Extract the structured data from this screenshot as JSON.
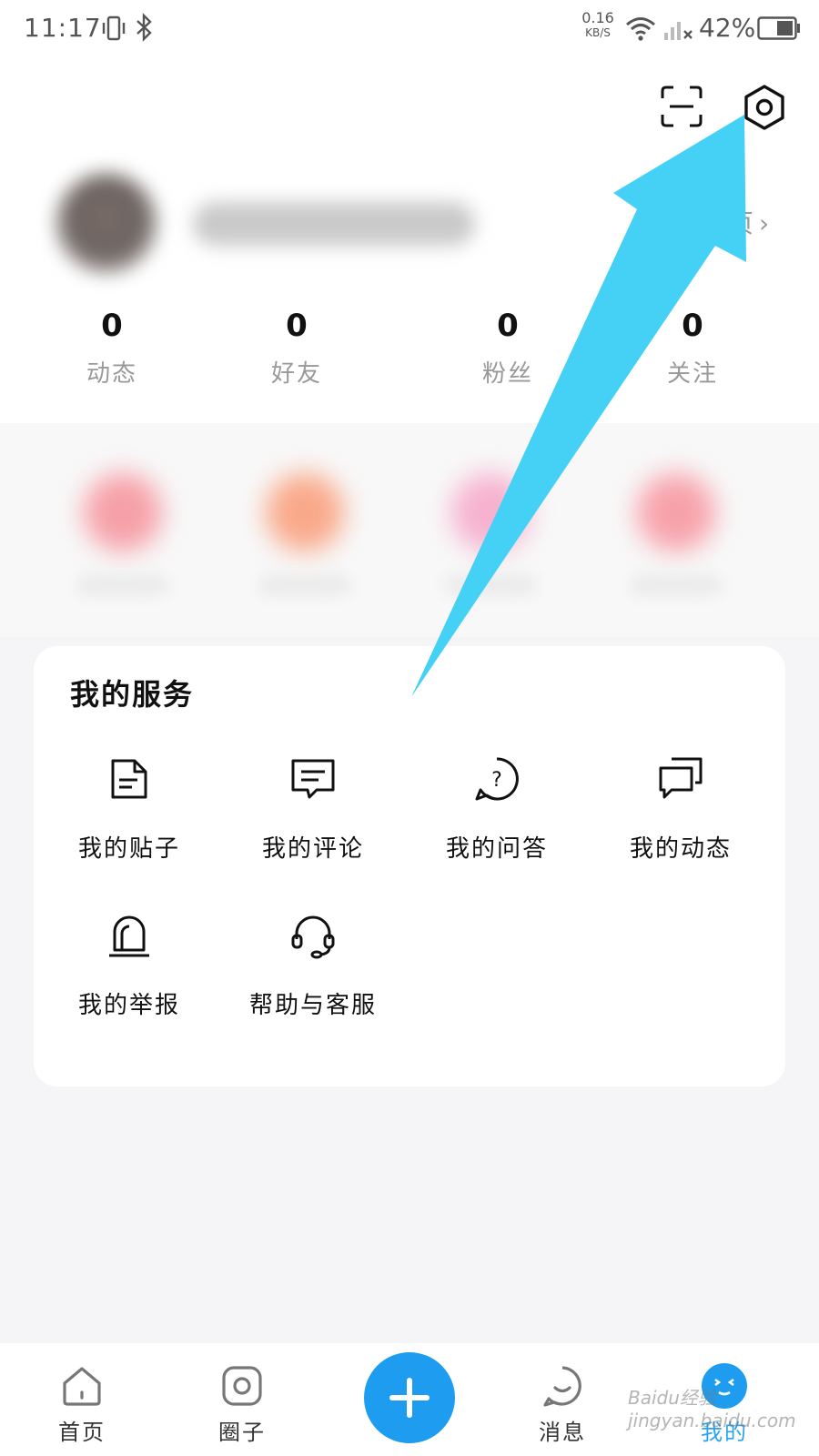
{
  "status_bar": {
    "time": "11:17",
    "net_speed_value": "0.16",
    "net_speed_unit": "KB/S",
    "battery_percent": "42%"
  },
  "profile": {
    "homepage_link": "页"
  },
  "stats": [
    {
      "value": "0",
      "label": "动态"
    },
    {
      "value": "0",
      "label": "好友"
    },
    {
      "value": "0",
      "label": "粉丝"
    },
    {
      "value": "0",
      "label": "关注"
    }
  ],
  "services": {
    "title": "我的服务",
    "items": [
      {
        "label": "我的贴子",
        "icon": "document-icon"
      },
      {
        "label": "我的评论",
        "icon": "comment-icon"
      },
      {
        "label": "我的问答",
        "icon": "question-icon"
      },
      {
        "label": "我的动态",
        "icon": "chat-bubbles-icon"
      },
      {
        "label": "我的举报",
        "icon": "alarm-report-icon"
      },
      {
        "label": "帮助与客服",
        "icon": "headset-icon"
      }
    ]
  },
  "bottom_nav": {
    "items": [
      {
        "label": "首页",
        "icon": "home-icon"
      },
      {
        "label": "圈子",
        "icon": "circle-icon"
      },
      {
        "label": "消息",
        "icon": "message-icon"
      },
      {
        "label": "我的",
        "icon": "mine-icon"
      }
    ],
    "add_icon": "plus-icon"
  },
  "watermark": "Baidu经验 jingyan.baidu.com",
  "colors": {
    "accent": "#1e9df0",
    "annotation_arrow": "#45d1f5"
  }
}
